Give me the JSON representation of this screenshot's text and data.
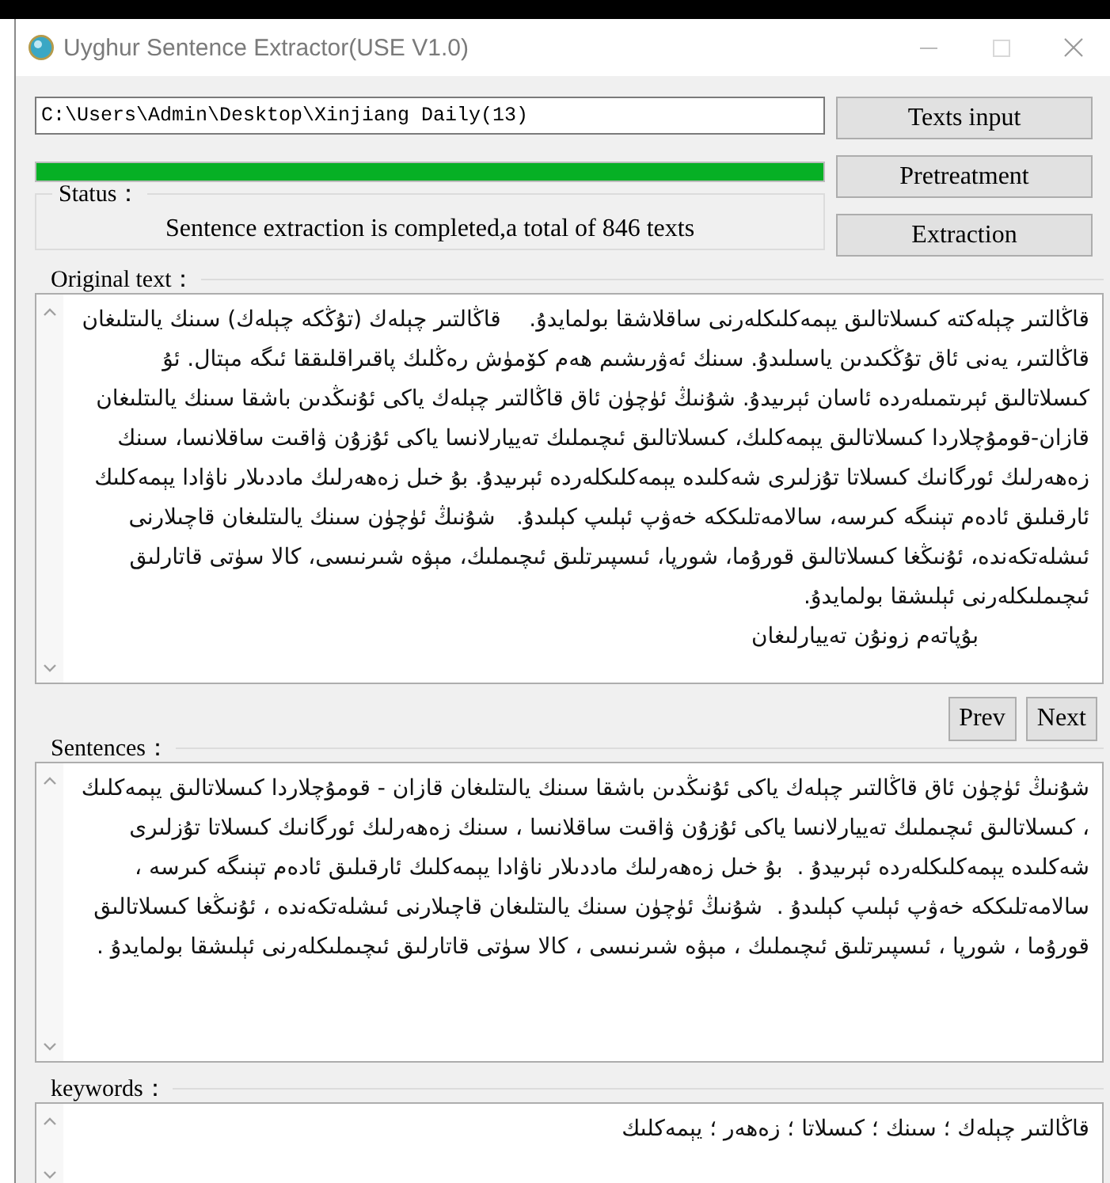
{
  "window": {
    "title": "Uyghur Sentence Extractor(USE V1.0)"
  },
  "input_row": {
    "path": "C:\\Users\\Admin\\Desktop\\Xinjiang Daily(13)",
    "button": "Texts input"
  },
  "progress": {
    "level": 1,
    "button": "Pretreatment"
  },
  "status": {
    "label": "Status：",
    "message": "Sentence extraction is completed,a total of 846 texts",
    "button": "Extraction"
  },
  "original_text": {
    "label": "Original text：",
    "paragraphs": [
      {
        "kind": "body",
        "text": "قاڭالتىر چېلەكتە كىسلاتالىق يېمەكلىكلەرنى ساقلاشقا بولمايدۇ.    قاڭالتىر چېلەك (تۇڭكە چېلەك) سىنك يالىتلىغان قاڭالتىر، يەنى ئاق تۇڭكىدىن ياسىلىدۇ. سىنك ئەۋرىشىم ھەم كۆمۈش رەڭلىك پاقىراقلىققا ئىگە مېتال. ئۇ كىسلاتالىق ئېرىتمىلەردە ئاسان ئېرىيدۇ. شۇنىڭ ئۈچۈن ئاق قاڭالتىر چېلەك ياكى ئۇنىڭدىن باشقا سىنك يالىتلىغان قازان-قومۇچلاردا كىسلاتالىق يېمەكلىك، كىسلاتالىق ئىچىملىك تەييارلانسا ياكى ئۇزۇن ۋاقىت ساقلانسا، سىنك زەھەرلىك ئورگانىك كىسلاتا تۇزلىرى شەكلىدە يېمەكلىكلەردە ئېرىيدۇ. بۇ خىل زەھەرلىك ماددىلار ناۋادا يېمەكلىك ئارقىلىق ئادەم تېنىگە كىرسە، سالامەتلىككە خەۋپ ئېلىپ كېلىدۇ.   شۇنىڭ ئۈچۈن سىنك يالىتلىغان قاچىلارنى ئىشلەتكەندە، ئۇنىڭغا كىسلاتالىق قورۇما، شورپا، ئىسپىرتلىق ئىچىملىك، مېۋە شىرنىسى، كالا سۈتى قاتارلىق ئىچىملىكلەرنى ئېلىشقا بولمايدۇ."
      },
      {
        "kind": "byline",
        "text": "بۇپاتەم زونۇن تەييارلىغان"
      }
    ]
  },
  "navigation": {
    "previous": "Prev",
    "next": "Next"
  },
  "sentences": {
    "label": "Sentences：",
    "text": "شۇنىڭ ئۈچۈن ئاق قاڭالتىر چېلەك ياكى ئۇنىڭدىن باشقا سىنك يالىتلىغان قازان - قومۇچلاردا كىسلاتالىق يېمەكلىك ، كىسلاتالىق ئىچىملىك تەييارلانسا ياكى ئۇزۇن ۋاقىت ساقلانسا ، سىنك زەھەرلىك ئورگانىك كىسلاتا تۇزلىرى شەكلىدە يېمەكلىكلەردە ئېرىيدۇ .  بۇ خىل زەھەرلىك ماددىلار ناۋادا يېمەكلىك ئارقىلىق ئادەم تېنىگە كىرسە ، سالامەتلىككە خەۋپ ئېلىپ كېلىدۇ .  شۇنىڭ ئۈچۈن سىنك يالىتلىغان قاچىلارنى ئىشلەتكەندە ، ئۇنىڭغا كىسلاتالىق قورۇما ، شورپا ، ئىسپىرتلىق ئىچىملىك ، مېۋە شىرنىسى ، كالا سۈتى قاتارلىق ئىچىملىكلەرنى ئېلىشقا بولمايدۇ ."
  },
  "keywords": {
    "label": "keywords：",
    "text": "قاڭالتىر چېلەك ؛ سىنك ؛ كىسلاتا ؛ زەھەر ؛ يېمەكلىك"
  }
}
